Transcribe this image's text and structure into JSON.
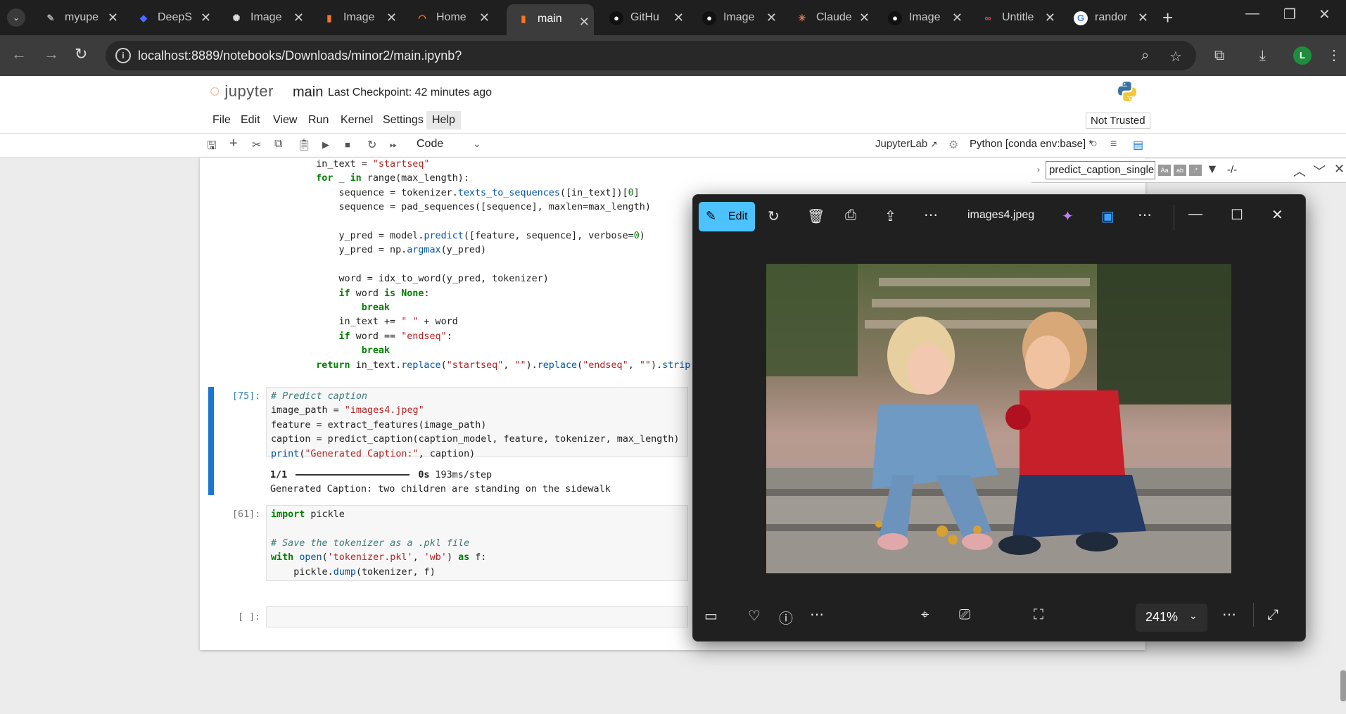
{
  "browser": {
    "tabs": [
      {
        "title": "myupe",
        "icon": "notebook-icon"
      },
      {
        "title": "DeepS",
        "icon": "deepseek-icon"
      },
      {
        "title": "Image",
        "icon": "openai-icon"
      },
      {
        "title": "Image",
        "icon": "jupyter-icon"
      },
      {
        "title": "Home",
        "icon": "jupyter-icon"
      },
      {
        "title": "main",
        "icon": "jupyter-icon",
        "active": true
      },
      {
        "title": "GitHu",
        "icon": "github-icon"
      },
      {
        "title": "Image",
        "icon": "github-icon"
      },
      {
        "title": "Claude",
        "icon": "claude-icon"
      },
      {
        "title": "Image",
        "icon": "github-icon"
      },
      {
        "title": "Untitle",
        "icon": "adobe-icon"
      },
      {
        "title": "randor",
        "icon": "google-icon"
      }
    ],
    "url": "localhost:8889/notebooks/Downloads/minor2/main.ipynb?",
    "profile_initial": "L"
  },
  "jupyter": {
    "logo_text": "jupyter",
    "notebook_name": "main",
    "checkpoint": "Last Checkpoint: 42 minutes ago",
    "menu": [
      "File",
      "Edit",
      "View",
      "Run",
      "Kernel",
      "Settings",
      "Help"
    ],
    "trust": "Not Trusted",
    "cell_type": "Code",
    "jupyterlab_link": "JupyterLab",
    "kernel": "Python [conda env:base] *"
  },
  "find": {
    "query": "predict_caption_single",
    "count": "-/-"
  },
  "cells": {
    "c75_prompt": "[75]:",
    "c75_output_progress": "1/1",
    "c75_output_time": "0s",
    "c75_output_step": "193ms/step",
    "c75_output_caption": "Generated Caption: two children are standing on the sidewalk",
    "c61_prompt": "[61]:",
    "empty_prompt": "[ ]:"
  },
  "viewer": {
    "edit_label": "Edit",
    "filename": "images4.jpeg",
    "zoom": "241%"
  }
}
